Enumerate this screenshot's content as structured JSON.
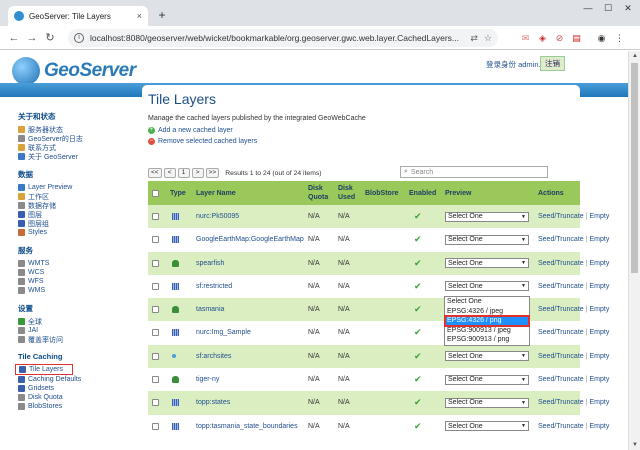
{
  "browser": {
    "tab_title": "GeoServer: Tile Layers",
    "tab_close": "×",
    "new_tab": "+",
    "url": "localhost:8080/geoserver/web/wicket/bookmarkable/org.geoserver.gwc.web.layer.CachedLayers...",
    "window_controls": [
      "—",
      "☐",
      "✕"
    ]
  },
  "header": {
    "logo_text": "GeoServer",
    "login_text": "登录身份 admin.",
    "logout_label": "注销"
  },
  "sidebar": {
    "sections": [
      {
        "title": "关于和状态",
        "items": [
          {
            "label": "服务器状态",
            "icon": "server-icon",
            "color": "#d9a23a"
          },
          {
            "label": "GeoServer的日志",
            "icon": "log-icon",
            "color": "#8a8a8a"
          },
          {
            "label": "联系方式",
            "icon": "contact-icon",
            "color": "#d9a23a"
          },
          {
            "label": "关于 GeoServer",
            "icon": "info-icon",
            "color": "#3a78c8"
          }
        ]
      },
      {
        "title": "数据",
        "items": [
          {
            "label": "Layer Preview",
            "icon": "preview-icon",
            "color": "#3a78c8"
          },
          {
            "label": "工作区",
            "icon": "workspace-icon",
            "color": "#d9a23a"
          },
          {
            "label": "数据存储",
            "icon": "store-icon",
            "color": "#8a8a8a"
          },
          {
            "label": "图层",
            "icon": "layers-icon",
            "color": "#3a5fb0"
          },
          {
            "label": "图层组",
            "icon": "layergroup-icon",
            "color": "#3a5fb0"
          },
          {
            "label": "Styles",
            "icon": "styles-icon",
            "color": "#c86a3a"
          }
        ]
      },
      {
        "title": "服务",
        "items": [
          {
            "label": "WMTS",
            "icon": "wmts-icon",
            "color": "#8a8a8a"
          },
          {
            "label": "WCS",
            "icon": "wcs-icon",
            "color": "#8a8a8a"
          },
          {
            "label": "WFS",
            "icon": "wfs-icon",
            "color": "#8a8a8a"
          },
          {
            "label": "WMS",
            "icon": "wms-icon",
            "color": "#8a8a8a"
          }
        ]
      },
      {
        "title": "设置",
        "items": [
          {
            "label": "全球",
            "icon": "global-icon",
            "color": "#3a9a3a"
          },
          {
            "label": "JAI",
            "icon": "jai-icon",
            "color": "#8a8a8a"
          },
          {
            "label": "覆盖率访问",
            "icon": "coverage-icon",
            "color": "#8a8a8a"
          }
        ]
      },
      {
        "title": "Tile Caching",
        "items": [
          {
            "label": "Tile Layers",
            "icon": "tile-layers-icon",
            "color": "#3a5fb0",
            "active": true
          },
          {
            "label": "Caching Defaults",
            "icon": "caching-defaults-icon",
            "color": "#3a5fb0"
          },
          {
            "label": "Gridsets",
            "icon": "gridsets-icon",
            "color": "#3a5fb0"
          },
          {
            "label": "Disk Quota",
            "icon": "disk-quota-icon",
            "color": "#8a8a8a"
          },
          {
            "label": "BlobStores",
            "icon": "blobstores-icon",
            "color": "#8a8a8a"
          }
        ]
      }
    ]
  },
  "main": {
    "title": "Tile Layers",
    "description": "Manage the cached layers published by the integrated GeoWebCache",
    "add_label": "Add a new cached layer",
    "remove_label": "Remove selected cached layers",
    "pager": {
      "buttons": [
        "<<",
        "<",
        "1",
        ">",
        ">>"
      ],
      "results": "Results 1 to 24 (out of 24 items)"
    },
    "search_placeholder": "Search",
    "columns": {
      "type": "Type",
      "layer_name": "Layer Name",
      "disk_quota": "Disk Quota",
      "disk_used": "Disk Used",
      "blobstore": "BlobStore",
      "enabled": "Enabled",
      "preview": "Preview",
      "actions": "Actions"
    },
    "rows": [
      {
        "type": "grid",
        "name": "nurc:Pk50095",
        "quota": "N/A",
        "used": "N/A",
        "preview": "Select One"
      },
      {
        "type": "grid",
        "name": "GoogleEarthMap:GoogleEarthMap",
        "quota": "N/A",
        "used": "N/A",
        "preview": "Select One"
      },
      {
        "type": "blob",
        "name": "spearfish",
        "quota": "N/A",
        "used": "N/A",
        "preview": "Select One"
      },
      {
        "type": "grid",
        "name": "sf:restricted",
        "quota": "N/A",
        "used": "N/A",
        "preview": "Select One"
      },
      {
        "type": "blob",
        "name": "tasmania",
        "quota": "N/A",
        "used": "N/A",
        "preview": "Select One"
      },
      {
        "type": "grid",
        "name": "nurc:Img_Sample",
        "quota": "N/A",
        "used": "N/A",
        "preview": "Select One"
      },
      {
        "type": "dot",
        "name": "sf:archsites",
        "quota": "N/A",
        "used": "N/A",
        "preview": "Select One"
      },
      {
        "type": "blob",
        "name": "tiger-ny",
        "quota": "N/A",
        "used": "N/A",
        "preview": "Select One"
      },
      {
        "type": "grid",
        "name": "topp:states",
        "quota": "N/A",
        "used": "N/A",
        "preview": "Select One"
      },
      {
        "type": "grid",
        "name": "topp:tasmania_state_boundaries",
        "quota": "N/A",
        "used": "N/A",
        "preview": "Select One"
      }
    ],
    "action_seed": "Seed/Truncate",
    "action_sep": "|",
    "action_empty": "Empty",
    "dropdown_options": [
      {
        "label": "Select One",
        "highlighted": false
      },
      {
        "label": "EPSG:4326 / jpeg",
        "highlighted": false
      },
      {
        "label": "EPSG:4326 / png",
        "highlighted": true
      },
      {
        "label": "EPSG:900913 / jpeg",
        "highlighted": false
      },
      {
        "label": "EPSG:900913 / png",
        "highlighted": false
      }
    ]
  },
  "colors": {
    "header_green": "#9bc85a",
    "alt_row": "#dbeec2",
    "link_blue": "#1f4f8f",
    "highlight": "#1e90ff",
    "callout_red": "#e03030"
  }
}
